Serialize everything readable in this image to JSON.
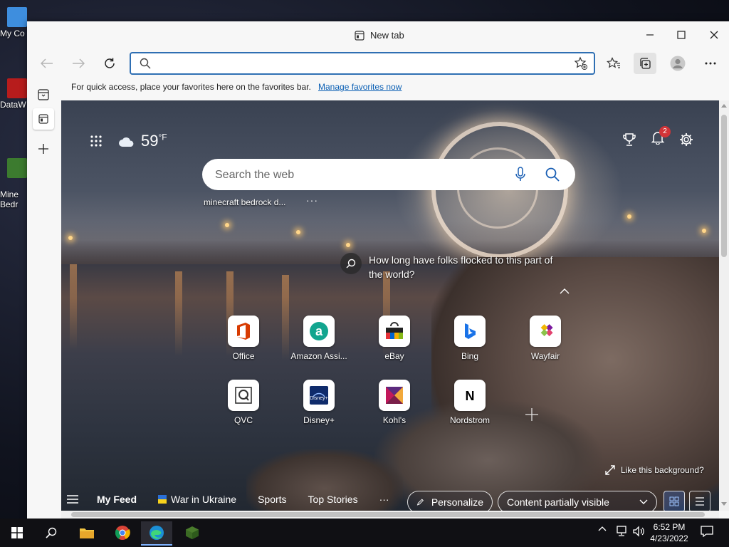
{
  "desktop": {
    "icons": [
      {
        "label": "My Co"
      },
      {
        "label": "DataW"
      },
      {
        "label": "Mine\nBedr"
      }
    ]
  },
  "browser": {
    "tab_title": "New tab",
    "address_value": "",
    "favorites_bar": {
      "message": "For quick access, place your favorites here on the favorites bar.",
      "link": "Manage favorites now"
    }
  },
  "newtab": {
    "weather": {
      "temp": "59",
      "unit": "°F"
    },
    "notification_count": "2",
    "search": {
      "placeholder": "Search the web"
    },
    "suggestion": "minecraft bedrock d...",
    "suggestion_more": "···",
    "image_caption": "How long have folks flocked to this part of the world?",
    "tiles": [
      {
        "label": "Office",
        "color": "#d83b01"
      },
      {
        "label": "Amazon Assi...",
        "color": "#12a58f"
      },
      {
        "label": "eBay",
        "color": "#e53238"
      },
      {
        "label": "Bing",
        "color": "#1a73e8"
      },
      {
        "label": "Wayfair",
        "color": "#7b189f"
      },
      {
        "label": "QVC",
        "color": "#333333"
      },
      {
        "label": "Disney+",
        "color": "#0f2b6b"
      },
      {
        "label": "Kohl's",
        "color": "#7a1f4a"
      },
      {
        "label": "Nordstrom",
        "color": "#000000"
      }
    ],
    "like_background": "Like this background?",
    "feed": {
      "my_feed": "My Feed",
      "items": [
        "War in Ukraine",
        "Sports",
        "Top Stories"
      ],
      "more": "···",
      "personalize": "Personalize",
      "content_visibility": "Content partially visible"
    }
  },
  "taskbar": {
    "time": "6:52 PM",
    "date": "4/23/2022"
  },
  "colors": {
    "accent": "#2f6fb3",
    "link": "#0a5fb4",
    "badge": "#d13438"
  }
}
